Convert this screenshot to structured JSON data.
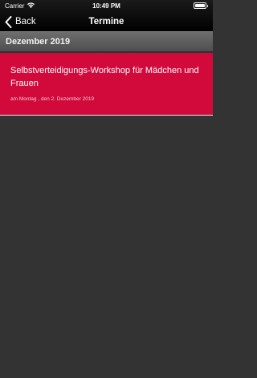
{
  "status_bar": {
    "carrier": "Carrier",
    "time": "10:49 PM",
    "wifi_icon": "wifi-icon",
    "battery_icon": "battery-icon"
  },
  "nav": {
    "back_label": "Back",
    "title": "Termine"
  },
  "section": {
    "title": "Dezember 2019"
  },
  "events": [
    {
      "title": "Selbstverteidigungs-Workshop für Mädchen und Frauen",
      "date": "am Montag , den 2. Dezember 2019"
    }
  ],
  "colors": {
    "background": "#333333",
    "accent": "#d10a3b",
    "nav_bar": "#000000"
  }
}
